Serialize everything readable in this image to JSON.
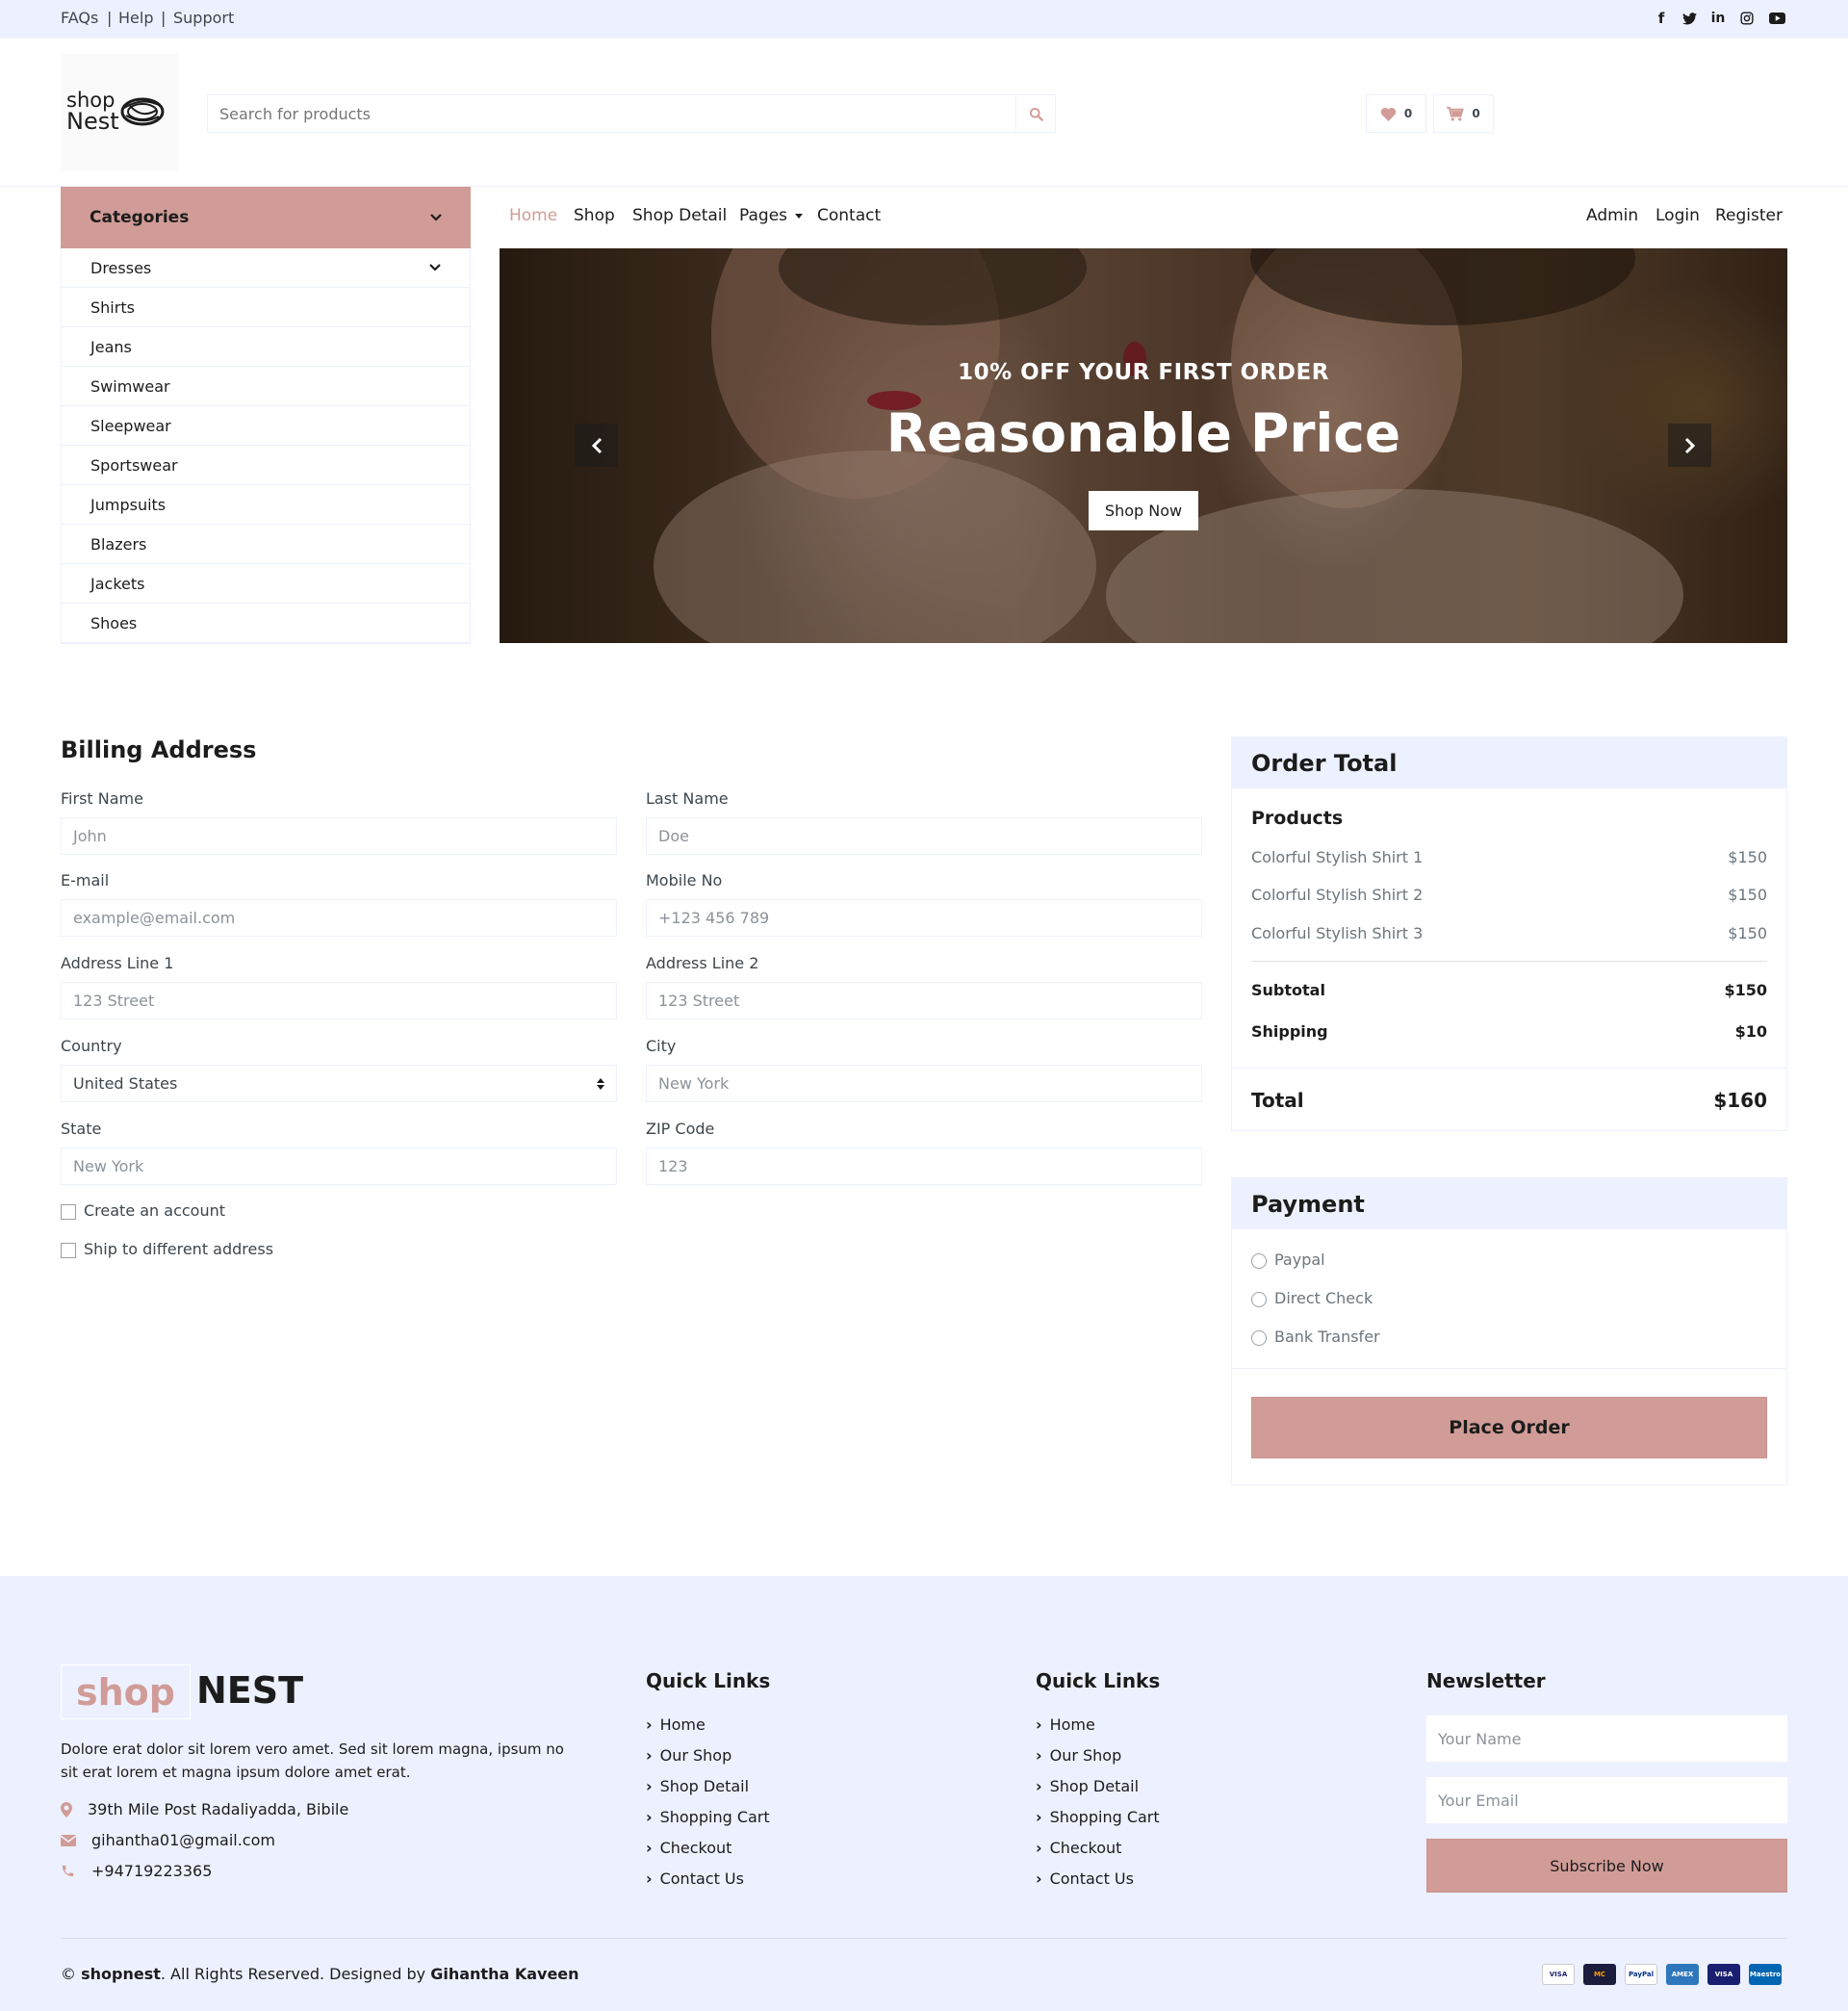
{
  "topbar": {
    "links": [
      "FAQs",
      "Help",
      "Support"
    ],
    "separator": "|",
    "social_icons": [
      "facebook-icon",
      "twitter-icon",
      "linkedin-icon",
      "instagram-icon",
      "youtube-icon"
    ]
  },
  "header": {
    "logo_line1": "shop",
    "logo_line2": "Nest",
    "search_placeholder": "Search for products",
    "wishlist_count": "0",
    "cart_count": "0"
  },
  "categories": {
    "title": "Categories",
    "items": [
      "Dresses",
      "Shirts",
      "Jeans",
      "Swimwear",
      "Sleepwear",
      "Sportswear",
      "Jumpsuits",
      "Blazers",
      "Jackets",
      "Shoes"
    ]
  },
  "nav": {
    "items": [
      "Home",
      "Shop",
      "Shop Detail",
      "Pages",
      "Contact"
    ],
    "active": "Home",
    "right_items": [
      "Admin",
      "Login",
      "Register"
    ]
  },
  "hero": {
    "subtitle": "10% OFF YOUR FIRST ORDER",
    "title": "Reasonable Price",
    "button": "Shop Now"
  },
  "billing": {
    "title": "Billing Address",
    "fields": {
      "first_name": {
        "label": "First Name",
        "placeholder": "John"
      },
      "last_name": {
        "label": "Last Name",
        "placeholder": "Doe"
      },
      "email": {
        "label": "E-mail",
        "placeholder": "example@email.com"
      },
      "mobile": {
        "label": "Mobile No",
        "placeholder": "+123 456 789"
      },
      "address1": {
        "label": "Address Line 1",
        "placeholder": "123 Street"
      },
      "address2": {
        "label": "Address Line 2",
        "placeholder": "123 Street"
      },
      "country": {
        "label": "Country",
        "value": "United States"
      },
      "city": {
        "label": "City",
        "placeholder": "New York"
      },
      "state": {
        "label": "State",
        "placeholder": "New York"
      },
      "zip": {
        "label": "ZIP Code",
        "placeholder": "123"
      }
    },
    "checkboxes": [
      "Create an account",
      "Ship to different address"
    ]
  },
  "order": {
    "title": "Order Total",
    "products_heading": "Products",
    "products": [
      {
        "name": "Colorful Stylish Shirt 1",
        "price": "$150"
      },
      {
        "name": "Colorful Stylish Shirt 2",
        "price": "$150"
      },
      {
        "name": "Colorful Stylish Shirt 3",
        "price": "$150"
      }
    ],
    "subtotal_label": "Subtotal",
    "subtotal": "$150",
    "shipping_label": "Shipping",
    "shipping": "$10",
    "total_label": "Total",
    "total": "$160"
  },
  "payment": {
    "title": "Payment",
    "options": [
      "Paypal",
      "Direct Check",
      "Bank Transfer"
    ],
    "button": "Place Order"
  },
  "footer": {
    "logo_part1": "shop",
    "logo_part2": "NEST",
    "description": "Dolore erat dolor sit lorem vero amet. Sed sit lorem magna, ipsum no sit erat lorem et magna ipsum dolore amet erat.",
    "address": "39th Mile Post Radaliyadda, Bibile",
    "email": "gihantha01@gmail.com",
    "phone": "+94719223365",
    "quick_links_title": "Quick Links",
    "quick_links": [
      "Home",
      "Our Shop",
      "Shop Detail",
      "Shopping Cart",
      "Checkout",
      "Contact Us"
    ],
    "newsletter_title": "Newsletter",
    "name_placeholder": "Your Name",
    "email_placeholder": "Your Email",
    "subscribe": "Subscribe Now",
    "copyright_prefix": "©",
    "brand": "shopnest",
    "rights": ". All Rights Reserved. Designed by",
    "designer": "Gihantha Kaveen",
    "payment_badges": [
      "VISA",
      "MC",
      "PayPal",
      "AMEX",
      "VISA",
      "Maestro"
    ]
  },
  "colors": {
    "primary": "#d19c97",
    "secondary": "#edf1ff",
    "dark": "#1c1c1c"
  }
}
